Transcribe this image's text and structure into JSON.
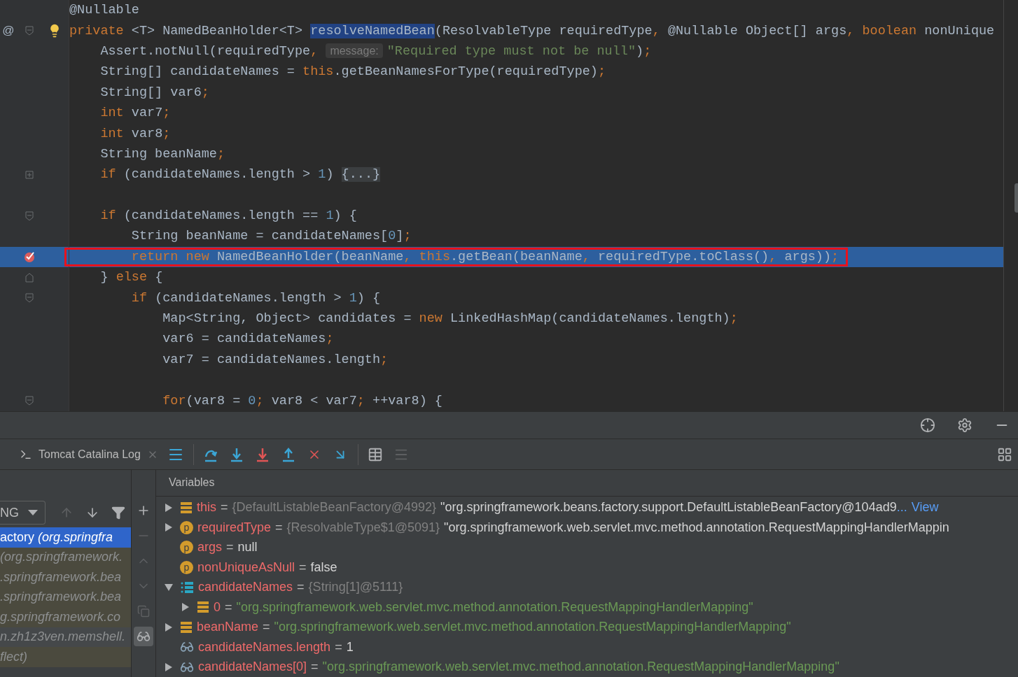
{
  "editor": {
    "lines": [
      {
        "kind": "plain",
        "current": false,
        "tokens": [
          {
            "kind": "text",
            "v": "@Nullable"
          }
        ]
      },
      {
        "kind": "method",
        "gutter_text": "@",
        "current": false,
        "tokens": [
          {
            "kind": "keyword",
            "v": "private "
          },
          {
            "kind": "text",
            "v": "<T> NamedBeanHolder<T> "
          },
          {
            "kind": "selection",
            "v": "resolveNamedBean"
          },
          {
            "kind": "text",
            "v": "(ResolvableType requiredType"
          },
          {
            "kind": "keyword",
            "v": ", "
          },
          {
            "kind": "text",
            "v": "@Nullable Object[] args"
          },
          {
            "kind": "keyword",
            "v": ", boolean "
          },
          {
            "kind": "text",
            "v": "nonUnique"
          }
        ]
      },
      {
        "kind": "plain",
        "current": false,
        "tokens": [
          {
            "kind": "text",
            "v": "    Assert.notNull(requiredType"
          },
          {
            "kind": "keyword",
            "v": ", "
          },
          {
            "kind": "hint",
            "v": "message:"
          },
          {
            "kind": "string",
            "v": "\"Required type must not be null\""
          },
          {
            "kind": "text",
            "v": ")"
          },
          {
            "kind": "keyword",
            "v": ";"
          }
        ]
      },
      {
        "kind": "plain",
        "current": false,
        "tokens": [
          {
            "kind": "text",
            "v": "    String[] candidateNames = "
          },
          {
            "kind": "keyword",
            "v": "this"
          },
          {
            "kind": "text",
            "v": ".getBeanNamesForType(requiredType)"
          },
          {
            "kind": "keyword",
            "v": ";"
          }
        ]
      },
      {
        "kind": "plain",
        "current": false,
        "tokens": [
          {
            "kind": "text",
            "v": "    String[] var6"
          },
          {
            "kind": "keyword",
            "v": ";"
          }
        ]
      },
      {
        "kind": "plain",
        "current": false,
        "tokens": [
          {
            "kind": "keyword",
            "v": "    int "
          },
          {
            "kind": "text",
            "v": "var7"
          },
          {
            "kind": "keyword",
            "v": ";"
          }
        ]
      },
      {
        "kind": "plain",
        "current": false,
        "tokens": [
          {
            "kind": "keyword",
            "v": "    int "
          },
          {
            "kind": "text",
            "v": "var8"
          },
          {
            "kind": "keyword",
            "v": ";"
          }
        ]
      },
      {
        "kind": "plain",
        "current": false,
        "tokens": [
          {
            "kind": "text",
            "v": "    String beanName"
          },
          {
            "kind": "keyword",
            "v": ";"
          }
        ]
      },
      {
        "kind": "fold-closed",
        "current": false,
        "tokens": [
          {
            "kind": "keyword",
            "v": "    if "
          },
          {
            "kind": "text",
            "v": "(candidateNames.length > "
          },
          {
            "kind": "number",
            "v": "1"
          },
          {
            "kind": "text",
            "v": ") "
          },
          {
            "kind": "folded",
            "v": "{...}"
          }
        ]
      },
      {
        "kind": "blank",
        "current": false
      },
      {
        "kind": "fold-open",
        "current": false,
        "tokens": [
          {
            "kind": "keyword",
            "v": "    if "
          },
          {
            "kind": "text",
            "v": "(candidateNames.length == "
          },
          {
            "kind": "number",
            "v": "1"
          },
          {
            "kind": "text",
            "v": ") {"
          }
        ]
      },
      {
        "kind": "plain",
        "current": false,
        "tokens": [
          {
            "kind": "text",
            "v": "        String beanName = candidateNames["
          },
          {
            "kind": "number",
            "v": "0"
          },
          {
            "kind": "text",
            "v": "]"
          },
          {
            "kind": "keyword",
            "v": ";"
          }
        ]
      },
      {
        "kind": "breakpoint",
        "current": true,
        "annotation_box": true,
        "tokens": [
          {
            "kind": "keyword",
            "v": "        return new "
          },
          {
            "kind": "text",
            "v": "NamedBeanHolder(beanName"
          },
          {
            "kind": "keyword",
            "v": ", this"
          },
          {
            "kind": "text",
            "v": ".getBean(beanName"
          },
          {
            "kind": "keyword",
            "v": ", "
          },
          {
            "kind": "text",
            "v": "requiredType.toClass()"
          },
          {
            "kind": "keyword",
            "v": ", "
          },
          {
            "kind": "text",
            "v": "args))"
          },
          {
            "kind": "keyword",
            "v": ";"
          }
        ]
      },
      {
        "kind": "fold-end",
        "current": false,
        "tokens": [
          {
            "kind": "text",
            "v": "    } "
          },
          {
            "kind": "keyword",
            "v": "else "
          },
          {
            "kind": "text",
            "v": "{"
          }
        ]
      },
      {
        "kind": "fold-open",
        "current": false,
        "tokens": [
          {
            "kind": "keyword",
            "v": "        if "
          },
          {
            "kind": "text",
            "v": "(candidateNames.length > "
          },
          {
            "kind": "number",
            "v": "1"
          },
          {
            "kind": "text",
            "v": ") {"
          }
        ]
      },
      {
        "kind": "plain",
        "current": false,
        "tokens": [
          {
            "kind": "text",
            "v": "            Map<String, Object> candidates = "
          },
          {
            "kind": "keyword",
            "v": "new "
          },
          {
            "kind": "text",
            "v": "LinkedHashMap(candidateNames.length)"
          },
          {
            "kind": "keyword",
            "v": ";"
          }
        ]
      },
      {
        "kind": "plain",
        "current": false,
        "tokens": [
          {
            "kind": "text",
            "v": "            var6 = candidateNames"
          },
          {
            "kind": "keyword",
            "v": ";"
          }
        ]
      },
      {
        "kind": "plain",
        "current": false,
        "tokens": [
          {
            "kind": "text",
            "v": "            var7 = candidateNames.length"
          },
          {
            "kind": "keyword",
            "v": ";"
          }
        ]
      },
      {
        "kind": "blank",
        "current": false
      },
      {
        "kind": "fold-open",
        "current": false,
        "tokens": [
          {
            "kind": "keyword",
            "v": "            for"
          },
          {
            "kind": "text",
            "v": "(var8 = "
          },
          {
            "kind": "number",
            "v": "0"
          },
          {
            "kind": "keyword",
            "v": "; "
          },
          {
            "kind": "text",
            "v": "var8 < var7"
          },
          {
            "kind": "keyword",
            "v": "; "
          },
          {
            "kind": "text",
            "v": "++var8) {"
          }
        ]
      }
    ]
  },
  "debug_tab": {
    "label": "Tomcat Catalina Log"
  },
  "frames": {
    "thread_dropdown": "NG",
    "items": [
      {
        "text": "actory *(org.springfra*",
        "selected": true,
        "library": false
      },
      {
        "text": "*(org.springframework.*",
        "selected": false,
        "library": true
      },
      {
        "text": "*.springframework.bea*",
        "selected": false,
        "library": true
      },
      {
        "text": "*.springframework.bea*",
        "selected": false,
        "library": true
      },
      {
        "text": "*g.springframework.co*",
        "selected": false,
        "library": true
      },
      {
        "text": "*n.zh1z3ven.memshell.*",
        "selected": false,
        "library": false
      },
      {
        "text": "*flect)*",
        "selected": false,
        "library": true
      }
    ]
  },
  "variables": {
    "title": "Variables",
    "items": [
      {
        "kind": "field",
        "expanded": false,
        "name": "this",
        "eq": "=",
        "ref": "{DefaultListableBeanFactory@4992}",
        "value": "\"org.springframework.beans.factory.support.DefaultListableBeanFactory@104ad9",
        "more": "...",
        "link": "View"
      },
      {
        "kind": "param",
        "badge": "p",
        "expanded": false,
        "name": "requiredType",
        "eq": "=",
        "ref": "{ResolvableType$1@5091}",
        "value": "\"org.springframework.web.servlet.mvc.method.annotation.RequestMappingHandlerMappin"
      },
      {
        "kind": "param-leaf",
        "badge": "p",
        "name": "args",
        "eq": "=",
        "value": "null"
      },
      {
        "kind": "param-leaf",
        "badge": "p",
        "name": "nonUniqueAsNull",
        "eq": "=",
        "value": "false"
      },
      {
        "kind": "array",
        "expanded": true,
        "name": "candidateNames",
        "eq": "=",
        "ref": "{String[1]@5111}",
        "children": [
          {
            "kind": "field",
            "expanded": false,
            "name": "0",
            "eq": "=",
            "string_value": "\"org.springframework.web.servlet.mvc.method.annotation.RequestMappingHandlerMapping\""
          }
        ]
      },
      {
        "kind": "field",
        "expanded": false,
        "name": "beanName",
        "eq": "=",
        "string_value": "\"org.springframework.web.servlet.mvc.method.annotation.RequestMappingHandlerMapping\""
      },
      {
        "kind": "watch-leaf",
        "name": "candidateNames.length",
        "eq": "=",
        "value": "1"
      },
      {
        "kind": "watch",
        "expanded": false,
        "name": "candidateNames[0]",
        "eq": "=",
        "string_value": "\"org.springframework.web.servlet.mvc.method.annotation.RequestMappingHandlerMapping\""
      }
    ]
  }
}
